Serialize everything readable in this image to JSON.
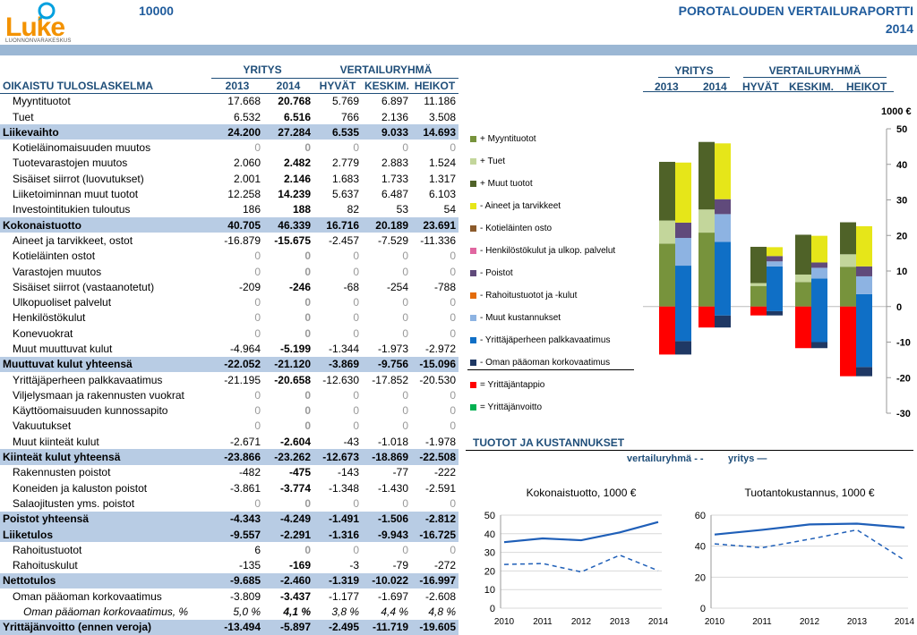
{
  "header": {
    "logo_text": "Luke",
    "logo_sub": "LUONNONVARAKESKUS",
    "id": "10000",
    "title": "POROTALOUDEN VERTAILURAPORTTI",
    "year": "2014"
  },
  "table": {
    "group_company": "YRITYS",
    "group_ref": "VERTAILURYHMÄ",
    "title": "OIKAISTU TULOSLASKELMA",
    "columns": [
      "2013",
      "2014",
      "HYVÄT",
      "KESKIM.",
      "HEIKOT"
    ],
    "rows": [
      {
        "label": "Myyntituotot",
        "type": "item",
        "v": [
          "17.668",
          "20.768",
          "5.769",
          "6.897",
          "11.186"
        ]
      },
      {
        "label": "Tuet",
        "type": "item",
        "v": [
          "6.532",
          "6.516",
          "766",
          "2.136",
          "3.508"
        ]
      },
      {
        "label": "Liikevaihto",
        "type": "sum",
        "v": [
          "24.200",
          "27.284",
          "6.535",
          "9.033",
          "14.693"
        ]
      },
      {
        "label": "Kotieläinomaisuuden muutos",
        "type": "item",
        "v": [
          "0",
          "0",
          "0",
          "0",
          "0"
        ]
      },
      {
        "label": "Tuotevarastojen muutos",
        "type": "item",
        "v": [
          "2.060",
          "2.482",
          "2.779",
          "2.883",
          "1.524"
        ]
      },
      {
        "label": "Sisäiset siirrot (luovutukset)",
        "type": "item",
        "v": [
          "2.001",
          "2.146",
          "1.683",
          "1.733",
          "1.317"
        ]
      },
      {
        "label": "Liiketoiminnan muut tuotot",
        "type": "item",
        "v": [
          "12.258",
          "14.239",
          "5.637",
          "6.487",
          "6.103"
        ]
      },
      {
        "label": "Investointitukien tuloutus",
        "type": "item",
        "v": [
          "186",
          "188",
          "82",
          "53",
          "54"
        ]
      },
      {
        "label": "Kokonaistuotto",
        "type": "sum",
        "v": [
          "40.705",
          "46.339",
          "16.716",
          "20.189",
          "23.691"
        ]
      },
      {
        "label": "Aineet ja tarvikkeet, ostot",
        "type": "item",
        "v": [
          "-16.879",
          "-15.675",
          "-2.457",
          "-7.529",
          "-11.336"
        ]
      },
      {
        "label": "Kotieläinten ostot",
        "type": "item",
        "v": [
          "0",
          "0",
          "0",
          "0",
          "0"
        ]
      },
      {
        "label": "Varastojen muutos",
        "type": "item",
        "v": [
          "0",
          "0",
          "0",
          "0",
          "0"
        ]
      },
      {
        "label": "Sisäiset siirrot (vastaanotetut)",
        "type": "item",
        "v": [
          "-209",
          "-246",
          "-68",
          "-254",
          "-788"
        ]
      },
      {
        "label": "Ulkopuoliset palvelut",
        "type": "item",
        "v": [
          "0",
          "0",
          "0",
          "0",
          "0"
        ]
      },
      {
        "label": "Henkilöstökulut",
        "type": "item",
        "v": [
          "0",
          "0",
          "0",
          "0",
          "0"
        ]
      },
      {
        "label": "Konevuokrat",
        "type": "item",
        "v": [
          "0",
          "0",
          "0",
          "0",
          "0"
        ]
      },
      {
        "label": "Muut muuttuvat kulut",
        "type": "item",
        "v": [
          "-4.964",
          "-5.199",
          "-1.344",
          "-1.973",
          "-2.972"
        ]
      },
      {
        "label": "Muuttuvat kulut yhteensä",
        "type": "sum",
        "v": [
          "-22.052",
          "-21.120",
          "-3.869",
          "-9.756",
          "-15.096"
        ]
      },
      {
        "label": "Yrittäjäperheen palkkavaatimus",
        "type": "item",
        "v": [
          "-21.195",
          "-20.658",
          "-12.630",
          "-17.852",
          "-20.530"
        ]
      },
      {
        "label": "Viljelysmaan ja rakennusten vuokrat",
        "type": "item",
        "v": [
          "0",
          "0",
          "0",
          "0",
          "0"
        ]
      },
      {
        "label": "Käyttöomaisuuden kunnossapito",
        "type": "item",
        "v": [
          "0",
          "0",
          "0",
          "0",
          "0"
        ]
      },
      {
        "label": "Vakuutukset",
        "type": "item",
        "v": [
          "0",
          "0",
          "0",
          "0",
          "0"
        ]
      },
      {
        "label": "Muut kiinteät kulut",
        "type": "item",
        "v": [
          "-2.671",
          "-2.604",
          "-43",
          "-1.018",
          "-1.978"
        ]
      },
      {
        "label": "Kiinteät kulut yhteensä",
        "type": "sum",
        "v": [
          "-23.866",
          "-23.262",
          "-12.673",
          "-18.869",
          "-22.508"
        ]
      },
      {
        "label": "Rakennusten poistot",
        "type": "item",
        "v": [
          "-482",
          "-475",
          "-143",
          "-77",
          "-222"
        ]
      },
      {
        "label": "Koneiden ja kaluston poistot",
        "type": "item",
        "v": [
          "-3.861",
          "-3.774",
          "-1.348",
          "-1.430",
          "-2.591"
        ]
      },
      {
        "label": "Salaojitusten yms. poistot",
        "type": "item",
        "v": [
          "0",
          "0",
          "0",
          "0",
          "0"
        ]
      },
      {
        "label": "Poistot yhteensä",
        "type": "sum",
        "v": [
          "-4.343",
          "-4.249",
          "-1.491",
          "-1.506",
          "-2.812"
        ]
      },
      {
        "label": "Liiketulos",
        "type": "sum",
        "v": [
          "-9.557",
          "-2.291",
          "-1.316",
          "-9.943",
          "-16.725"
        ]
      },
      {
        "label": "Rahoitustuotot",
        "type": "item",
        "v": [
          "6",
          "0",
          "0",
          "0",
          "0"
        ]
      },
      {
        "label": "Rahoituskulut",
        "type": "item",
        "v": [
          "-135",
          "-169",
          "-3",
          "-79",
          "-272"
        ]
      },
      {
        "label": "Nettotulos",
        "type": "sum",
        "v": [
          "-9.685",
          "-2.460",
          "-1.319",
          "-10.022",
          "-16.997"
        ]
      },
      {
        "label": "Oman pääoman korkovaatimus",
        "type": "item",
        "v": [
          "-3.809",
          "-3.437",
          "-1.177",
          "-1.697",
          "-2.608"
        ]
      },
      {
        "label": "Oman pääoman korkovaatimus, %",
        "type": "ital",
        "v": [
          "5,0 %",
          "4,1 %",
          "3,8 %",
          "4,4 %",
          "4,8 %"
        ]
      },
      {
        "label": "Yrittäjänvoitto (ennen veroja)",
        "type": "sum",
        "v": [
          "-13.494",
          "-5.897",
          "-2.495",
          "-11.719",
          "-19.605"
        ]
      }
    ]
  },
  "legend": [
    {
      "label": "+ Myyntituotot",
      "color": "#77933c"
    },
    {
      "label": "+ Tuet",
      "color": "#c3d69b"
    },
    {
      "label": "+ Muut tuotot",
      "color": "#4f6228"
    },
    {
      "label": "- Aineet ja tarvikkeet",
      "color": "#e6e619"
    },
    {
      "label": "- Kotieläinten osto",
      "color": "#8b5a2b"
    },
    {
      "label": "- Henkilöstökulut ja ulkop. palvelut",
      "color": "#e066a0"
    },
    {
      "label": "- Poistot",
      "color": "#604a7b"
    },
    {
      "label": "- Rahoitustuotot ja -kulut",
      "color": "#e46c0a"
    },
    {
      "label": "- Muut kustannukset",
      "color": "#8db3e2"
    },
    {
      "label": "- Yrittäjäperheen palkkavaatimus",
      "color": "#0f6fc6"
    },
    {
      "label": "- Oman pääoman korkovaatimus",
      "color": "#1f3864"
    },
    {
      "label": "= Yrittäjäntappio",
      "color": "#ff0000"
    },
    {
      "label": "= Yrittäjänvoitto",
      "color": "#00b050"
    }
  ],
  "bar_chart_labels": {
    "group_company": "YRITYS",
    "group_ref": "VERTAILURYHMÄ",
    "columns": [
      "2013",
      "2014",
      "HYVÄT",
      "KESKIM.",
      "HEIKOT"
    ],
    "unit": "1000 €"
  },
  "bottom": {
    "title": "TUOTOT JA KUSTANNUKSET",
    "legend_ref": "vertailuryhmä - -",
    "legend_company": "yritys —"
  },
  "chart_data": [
    {
      "type": "bar",
      "stacked": true,
      "categories": [
        "2013",
        "2014",
        "HYVÄT",
        "KESKIM.",
        "HEIKOT"
      ],
      "ylim": [
        -30,
        50
      ],
      "yticks": [
        50,
        40,
        30,
        20,
        10,
        0,
        -10,
        -20,
        -30
      ],
      "unit": "1000 €",
      "income_stacks": [
        {
          "name": "+ Myyntituotot",
          "values": [
            17.7,
            20.8,
            5.8,
            6.9,
            11.2
          ]
        },
        {
          "name": "+ Tuet",
          "values": [
            6.5,
            6.5,
            0.8,
            2.1,
            3.5
          ]
        },
        {
          "name": "+ Muut tuotot",
          "values": [
            16.5,
            19.0,
            10.2,
            11.2,
            9.0
          ]
        }
      ],
      "cost_stacks": [
        {
          "name": "- Aineet ja tarvikkeet",
          "values": [
            16.9,
            15.7,
            2.5,
            7.5,
            11.3
          ]
        },
        {
          "name": "- Poistot",
          "values": [
            4.3,
            4.2,
            1.5,
            1.5,
            2.8
          ]
        },
        {
          "name": "- Muut kustannukset",
          "values": [
            7.8,
            7.8,
            1.4,
            3.0,
            5.0
          ]
        },
        {
          "name": "- Yrittäjäperheen palkkavaatimus",
          "values": [
            21.2,
            20.7,
            12.6,
            17.9,
            20.5
          ]
        },
        {
          "name": "- Oman pääoman korkovaatimus",
          "values": [
            3.8,
            3.4,
            1.2,
            1.7,
            2.6
          ]
        }
      ],
      "result": {
        "name": "= Yrittäjäntappio",
        "values": [
          -13.5,
          -5.9,
          -2.5,
          -11.7,
          -19.6
        ]
      }
    },
    {
      "type": "line",
      "title": "Kokonaistuotto, 1000 €",
      "x": [
        2010,
        2011,
        2012,
        2013,
        2014
      ],
      "ylim": [
        0,
        50
      ],
      "yticks": [
        0,
        10,
        20,
        30,
        40,
        50
      ],
      "series": [
        {
          "name": "yritys",
          "values": [
            35.5,
            37.5,
            36.5,
            40.7,
            46.3
          ]
        },
        {
          "name": "vertailuryhmä",
          "values": [
            23.5,
            24.0,
            19.5,
            28.5,
            20.2
          ]
        }
      ]
    },
    {
      "type": "line",
      "title": "Tuotantokustannus, 1000 €",
      "x": [
        2010,
        2011,
        2012,
        2013,
        2014
      ],
      "ylim": [
        0,
        60
      ],
      "yticks": [
        0,
        20,
        40,
        60
      ],
      "series": [
        {
          "name": "yritys",
          "values": [
            47.5,
            50.5,
            54.0,
            54.5,
            52.0
          ]
        },
        {
          "name": "vertailuryhmä",
          "values": [
            41.5,
            39.0,
            44.5,
            50.5,
            31.0
          ]
        }
      ]
    }
  ]
}
